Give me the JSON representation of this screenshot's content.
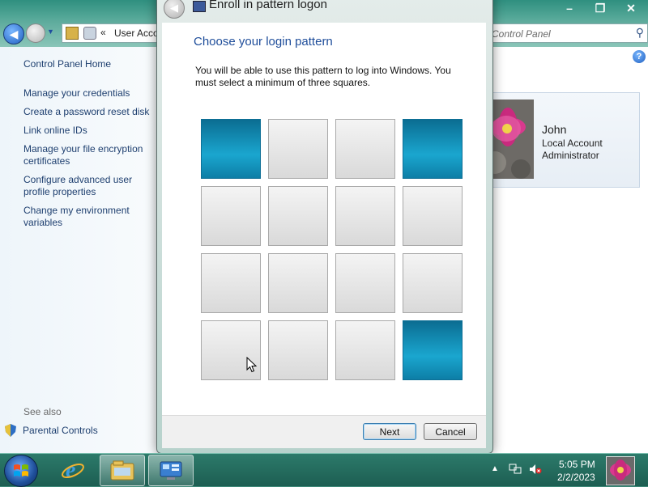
{
  "control_panel": {
    "address": {
      "chevrons": "«",
      "path": "User Accou",
      "search_placeholder": "Control Panel"
    },
    "window_buttons": {
      "minimize": "–",
      "restore": "❐",
      "close": "✕"
    },
    "left_pane": {
      "home": "Control Panel Home",
      "links": [
        "Manage your credentials",
        "Create a password reset disk",
        "Link online IDs",
        "Manage your file encryption certificates",
        "Configure advanced user profile properties",
        "Change my environment variables"
      ],
      "see_also": "See also",
      "parental_controls": "Parental Controls"
    },
    "user_card": {
      "name": "John",
      "account_type": "Local Account",
      "role": "Administrator"
    }
  },
  "dialog": {
    "title": "Enroll in pattern logon",
    "heading": "Choose your login pattern",
    "description": "You will be able to use this pattern to log into Windows. You must select a minimum of three squares.",
    "grid": {
      "rows": 4,
      "cols": 4,
      "selected": [
        [
          true,
          false,
          false,
          true
        ],
        [
          false,
          false,
          false,
          false
        ],
        [
          false,
          false,
          false,
          false
        ],
        [
          false,
          false,
          false,
          true
        ]
      ]
    },
    "next_label": "Next",
    "cancel_label": "Cancel"
  },
  "taskbar": {
    "time": "5:05 PM",
    "date": "2/2/2023",
    "tray_arrow": "▲"
  },
  "colors": {
    "selected_square": "#1aa6cf",
    "unselected_square": "#e6e6e6",
    "heading": "#1e4d9a",
    "link": "#1e3f6f"
  }
}
